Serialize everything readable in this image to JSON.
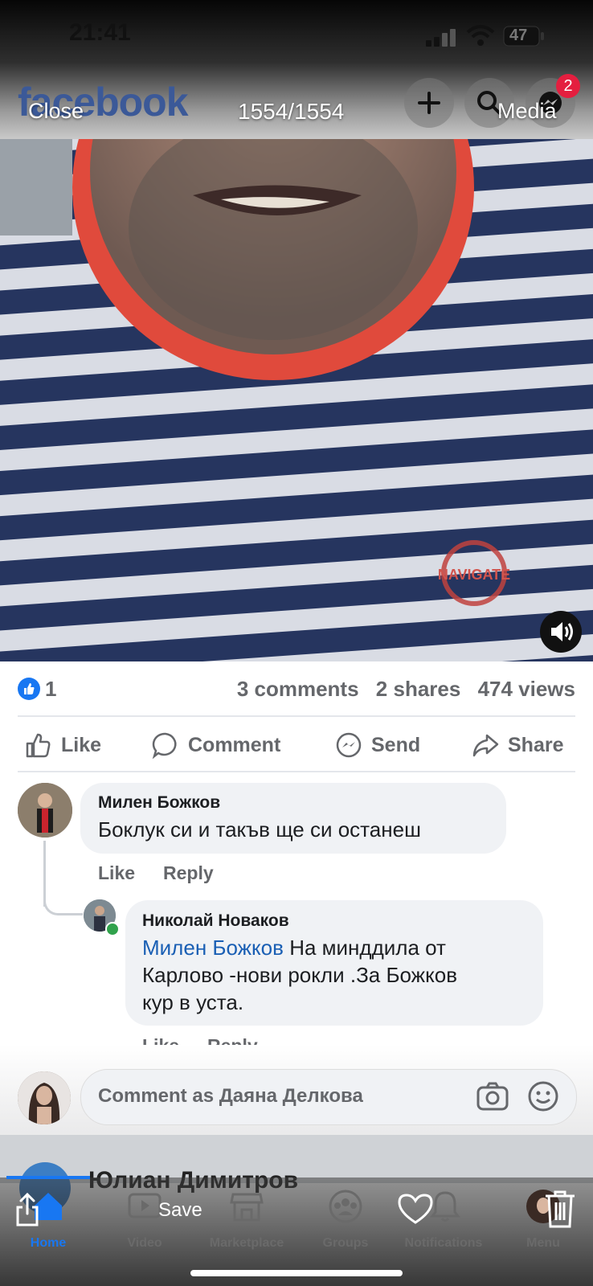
{
  "status_bar": {
    "time": "21:41",
    "battery": "47"
  },
  "header": {
    "logo": "facebook",
    "messenger_badge": "2"
  },
  "viewer": {
    "close_label": "Close",
    "counter": "1554/1554",
    "media_label": "Media",
    "save_label": "Save"
  },
  "video": {
    "shirt_logo_text": "NAVIGATE"
  },
  "stats": {
    "reactions": "1",
    "comments": "3 comments",
    "shares": "2 shares",
    "views": "474 views"
  },
  "actions": {
    "like": "Like",
    "comment": "Comment",
    "send": "Send",
    "share": "Share"
  },
  "comments": [
    {
      "author": "Милен Божков",
      "text": "Боклук си и такъв ще си останеш",
      "like": "Like",
      "reply": "Reply"
    },
    {
      "author": "Николай Новаков",
      "mention": "Милен Божков",
      "text_line1": " На минддила от",
      "text_line2": "Карлово -нови рокли .За Божков",
      "text_line3": "кур в уста.",
      "like": "Like",
      "reply": "Reply"
    }
  ],
  "composer": {
    "placeholder": "Comment as Даяна Делкова"
  },
  "next_post": {
    "author": "Юлиан Димитров"
  },
  "tabs": [
    {
      "label": "Home",
      "icon": "home-icon"
    },
    {
      "label": "Video",
      "icon": "video-icon"
    },
    {
      "label": "Marketplace",
      "icon": "marketplace-icon"
    },
    {
      "label": "Groups",
      "icon": "groups-icon"
    },
    {
      "label": "Notifications",
      "icon": "bell-icon"
    },
    {
      "label": "Menu",
      "icon": "avatar"
    }
  ],
  "colors": {
    "fb_blue": "#1877f2",
    "badge_red": "#e41e3f",
    "mention_blue": "#1a5fb4"
  }
}
